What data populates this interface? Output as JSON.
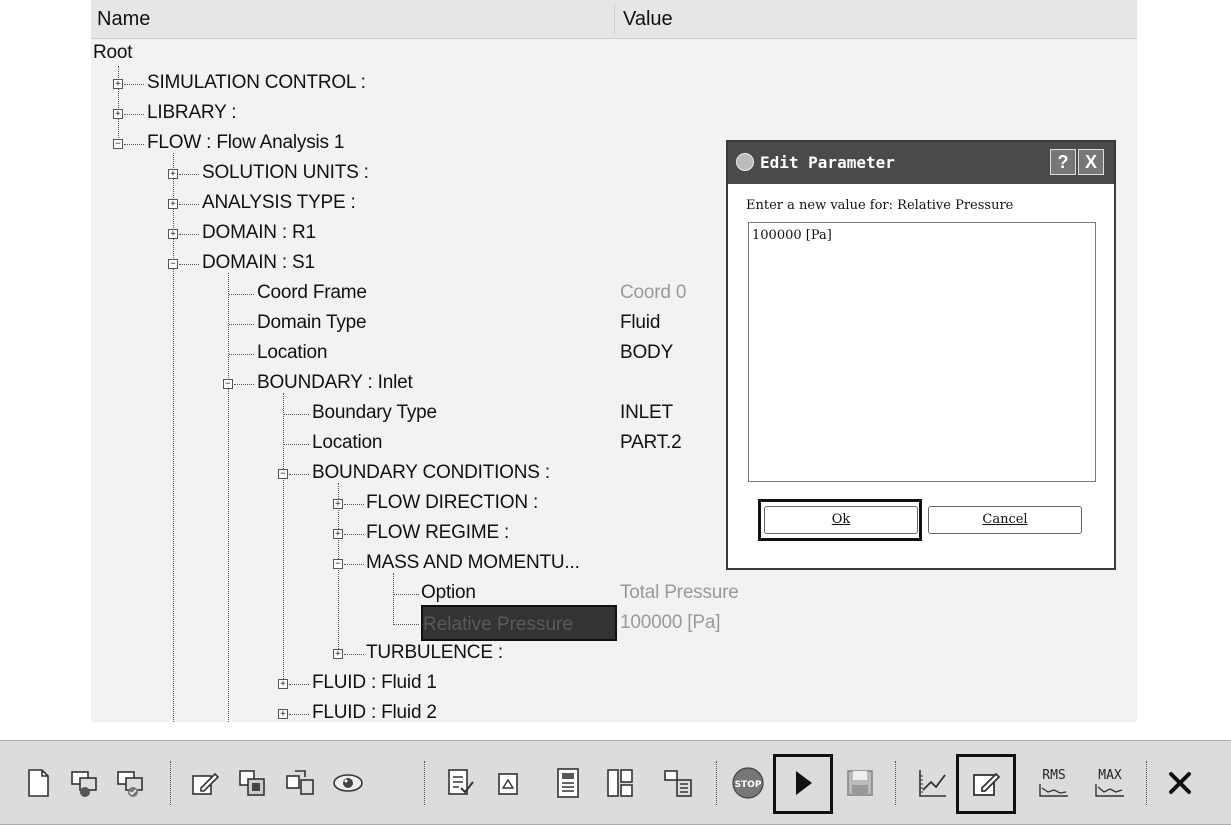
{
  "tree": {
    "header": {
      "name": "Name",
      "value": "Value"
    },
    "root": "Root",
    "simulation_control": "SIMULATION CONTROL :",
    "library": "LIBRARY :",
    "flow": "FLOW : Flow Analysis 1",
    "solution_units": "SOLUTION UNITS :",
    "analysis_type": "ANALYSIS TYPE :",
    "domain_r1": "DOMAIN : R1",
    "domain_s1": "DOMAIN : S1",
    "coord_frame": {
      "label": "Coord Frame",
      "value": "Coord 0"
    },
    "domain_type": {
      "label": "Domain Type",
      "value": "Fluid"
    },
    "location_domain": {
      "label": "Location",
      "value": "BODY"
    },
    "boundary_inlet": "BOUNDARY : Inlet",
    "boundary_type": {
      "label": "Boundary Type",
      "value": "INLET"
    },
    "location_boundary": {
      "label": "Location",
      "value": "PART.2"
    },
    "boundary_conditions": "BOUNDARY CONDITIONS :",
    "flow_direction": "FLOW DIRECTION :",
    "flow_regime": "FLOW REGIME :",
    "mass_momentum": "MASS AND MOMENTU...",
    "option": {
      "label": "Option",
      "value": "Total Pressure"
    },
    "relative_pressure": {
      "label": "Relative Pressure",
      "value": "100000 [Pa]"
    },
    "turbulence": "TURBULENCE :",
    "fluid_1": "FLUID : Fluid 1",
    "fluid_2": "FLUID : Fluid 2"
  },
  "dialog": {
    "title": "Edit Parameter",
    "help_label": "?",
    "close_label": "X",
    "prompt": "Enter a new value for: Relative Pressure",
    "input_value": "100000 [Pa]",
    "ok_label": "Ok",
    "cancel_label": "Cancel"
  },
  "toolbar": {
    "rms_label": "RMS",
    "max_label": "MAX",
    "stop_label": "STOP",
    "icons": [
      "new-file-icon",
      "import-icon",
      "export-icon",
      "edit-icon",
      "copy-icon",
      "transfer-icon",
      "eye-icon",
      "checklist-icon",
      "document-icon",
      "report-icon",
      "layout-icon",
      "tree-icon",
      "stop-icon",
      "play-icon",
      "save-icon",
      "monitor-plot-icon",
      "edit-parameter-icon",
      "rms-plot-icon",
      "max-plot-icon",
      "close-icon"
    ]
  }
}
